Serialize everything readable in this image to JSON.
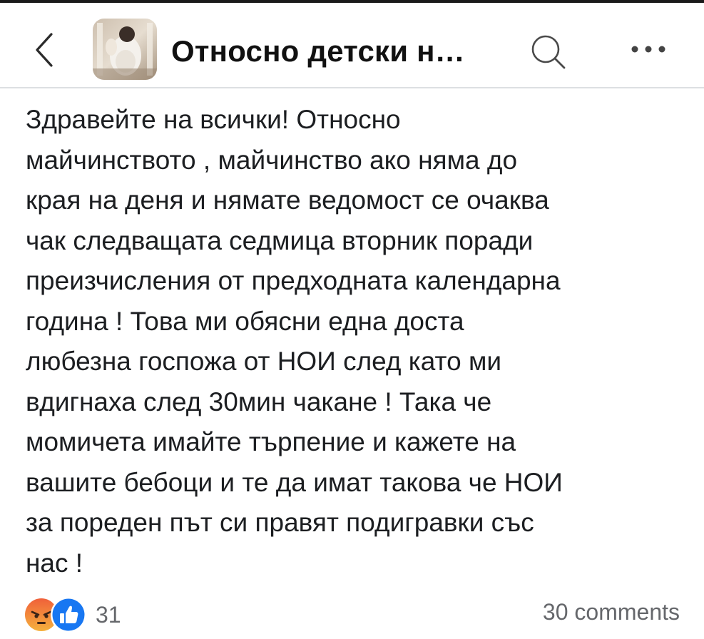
{
  "header": {
    "title": "Относно детски н…"
  },
  "post": {
    "text": "Здравейте на всички! Относно\nмайчинството , майчинство ако няма до\nкрая на деня и нямате ведомост се очаква\nчак следващата седмица вторник поради\nпреизчисления от предходната календарна\nгодина ! Това ми обясни една доста\nлюбезна госпожа от НОИ след като ми\nвдигнаха след 30мин чакане ! Така че\nмомичета имайте търпение и кажете на\nвашите бебоци и те да имат такова че НОИ\nза пореден път си правят подигравки със\nнас !"
  },
  "footer": {
    "reaction_count": "31",
    "comments_count": "30 comments"
  },
  "colors": {
    "like": "#1877f2",
    "angry": "#f0603a",
    "muted_text": "#65676b"
  },
  "icons": {
    "back": "chevron-left-icon",
    "search": "search-icon",
    "more": "more-horizontal-icon",
    "reaction_angry": "angry-reaction-icon",
    "reaction_like": "like-reaction-icon"
  }
}
